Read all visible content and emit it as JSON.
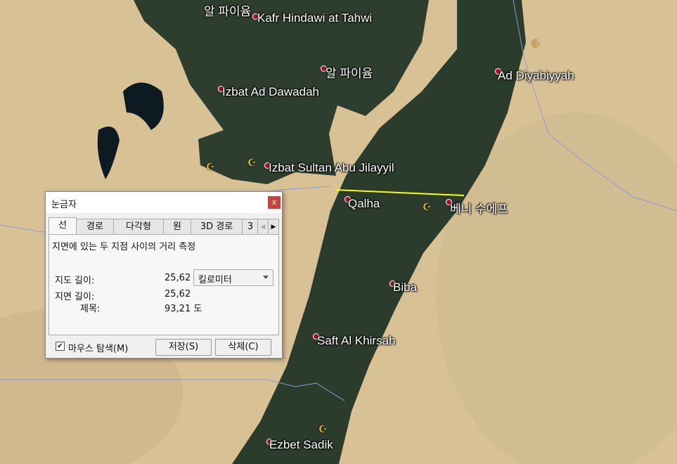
{
  "map": {
    "labels": {
      "fayoum_top": "알 파이윰",
      "kafr_hindawi": "Kafr Hindawi at Tahwi",
      "fayoum": "알 파이윰",
      "izbat_dawadah": "Izbat Ad Dawadah",
      "ad_diyabiyyah": "Ad Diyabiyyah",
      "izbat_sultan": "Izbat Sultan Abu Jilayyil",
      "qalha": "Qalha",
      "beni_suef": "베니 수에프",
      "biba": "Biba",
      "saft": "Saft Al Khirsah",
      "ezbet_sadik": "Ezbet Sadik"
    },
    "colors": {
      "desert": "#d9c196",
      "valley": "#2b3b2c",
      "water": "#0e1a22",
      "ruler_line": "#ffff00",
      "border": "#8c9bd6"
    }
  },
  "ruler": {
    "title": "눈금자",
    "close": "x",
    "tabs": [
      "선",
      "경로",
      "다각형",
      "원",
      "3D 경로",
      "3"
    ],
    "description": "지면에 있는 두 지점 사이의 거리 측정",
    "map_length_label": "지도 길이:",
    "map_length_value": "25,62",
    "unit": "킬로미터",
    "ground_length_label": "지면 길이:",
    "ground_length_value": "25,62",
    "heading_label": "제목:",
    "heading_value": "93,21 도",
    "mouse_nav_label": "마우스 탐색(M)",
    "mouse_nav_checked": true,
    "check_mark": "✔",
    "save_label": "저장(S)",
    "delete_label": "삭제(C)"
  }
}
